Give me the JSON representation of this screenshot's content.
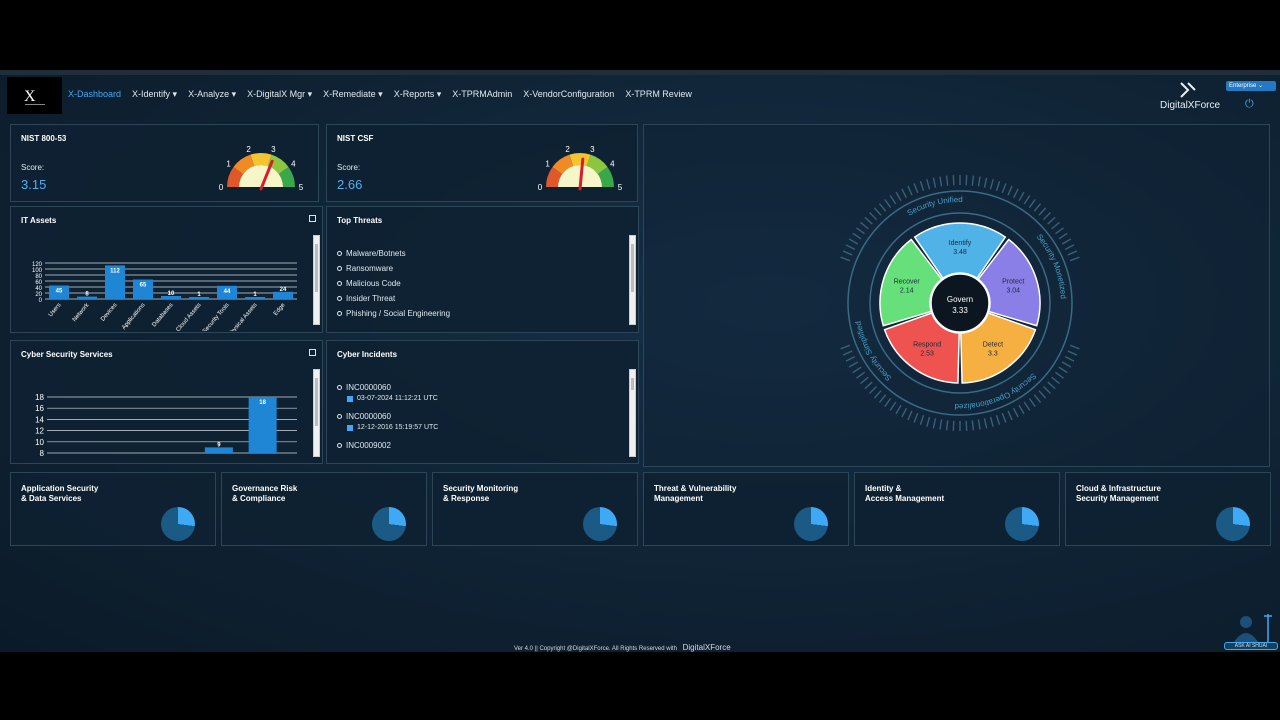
{
  "nav": {
    "logo_text": "X",
    "items": [
      {
        "label": "X-Dashboard",
        "active": true
      },
      {
        "label": "X-Identify ▾"
      },
      {
        "label": "X-Analyze ▾"
      },
      {
        "label": "X-DigitalX Mgr ▾"
      },
      {
        "label": "X-Remediate ▾"
      },
      {
        "label": "X-Reports ▾"
      },
      {
        "label": "X-TPRMAdmin"
      },
      {
        "label": "X-VendorConfiguration"
      },
      {
        "label": "X-TPRM Review"
      }
    ],
    "brand": "DigitalXForce",
    "plan": "Enterprise ⌄",
    "power_icon": "power-icon"
  },
  "nist80053": {
    "title": "NIST 800-53",
    "score_label": "Score:",
    "score": "3.15",
    "score_value": 3.15
  },
  "nistcsf": {
    "title": "NIST CSF",
    "score_label": "Score:",
    "score": "2.66",
    "score_value": 2.66
  },
  "gauge": {
    "ticks": [
      "0",
      "1",
      "2",
      "3",
      "4",
      "5"
    ]
  },
  "it_assets": {
    "title": "IT Assets",
    "chart_data": {
      "type": "bar",
      "categories": [
        "Users",
        "Network",
        "Devices",
        "Applications",
        "Databases",
        "Cloud Assets",
        "Security Tools",
        "Physical Assets",
        "Edge"
      ],
      "values": [
        45,
        8,
        112,
        65,
        10,
        1,
        44,
        1,
        24
      ],
      "value_labels": [
        "45",
        "8",
        "112",
        "65",
        "10",
        "1",
        "44",
        "1",
        "24"
      ],
      "yticks": [
        "120",
        "100",
        "80",
        "60",
        "40",
        "20",
        "0"
      ],
      "ylim": [
        0,
        120
      ]
    }
  },
  "top_threats": {
    "title": "Top Threats",
    "items": [
      "Malware/Botnets",
      "Ransomware",
      "Malicious Code",
      "Insider Threat",
      "Phishing / Social Engineering"
    ]
  },
  "cyber_services": {
    "title": "Cyber Security Services",
    "chart_data": {
      "type": "bar",
      "values": [
        9,
        18
      ],
      "value_labels": [
        "9",
        "18"
      ],
      "yticks": [
        "18",
        "16",
        "14",
        "12",
        "10",
        "8"
      ],
      "ylim": [
        8,
        18
      ]
    }
  },
  "incidents": {
    "title": "Cyber Incidents",
    "items": [
      {
        "id": "INC0000060",
        "date": "03-07-2024 11:12:21 UTC"
      },
      {
        "id": "INC0000060",
        "date": "12-12-2016 15:19:57 UTC"
      },
      {
        "id": "INC0009002",
        "date": ""
      }
    ]
  },
  "wheel": {
    "center": {
      "name": "Govern",
      "score": "3.33"
    },
    "segments": [
      {
        "name": "Identify",
        "score": "3.48",
        "color": "#4fb3e8"
      },
      {
        "name": "Protect",
        "score": "3.04",
        "color": "#8a7fe6"
      },
      {
        "name": "Detect",
        "score": "3.3",
        "color": "#f5b041"
      },
      {
        "name": "Respond",
        "score": "2.53",
        "color": "#ef5350"
      },
      {
        "name": "Recover",
        "score": "2.14",
        "color": "#66e07a"
      }
    ],
    "ring_labels": [
      "Security Unified",
      "Security Monetized",
      "Security Operationalized",
      "Security Simplified"
    ]
  },
  "tiles": [
    {
      "line1": "Application Security",
      "line2": "& Data Services"
    },
    {
      "line1": "Governance Risk",
      "line2": "& Compliance"
    },
    {
      "line1": "Security Monitoring",
      "line2": "& Response"
    },
    {
      "line1": "Threat & Vulnerability",
      "line2": "Management"
    },
    {
      "line1": "Identity &",
      "line2": "Access Management"
    },
    {
      "line1": "Cloud & Infrastructure",
      "line2": "Security Management"
    }
  ],
  "footer": {
    "text": "Ver 4.0 || Copyright @DigitalXForce. All Rights Reserved with",
    "brand": "DigitalXForce"
  },
  "assistant": {
    "label": "ASK AI SHUAI"
  }
}
